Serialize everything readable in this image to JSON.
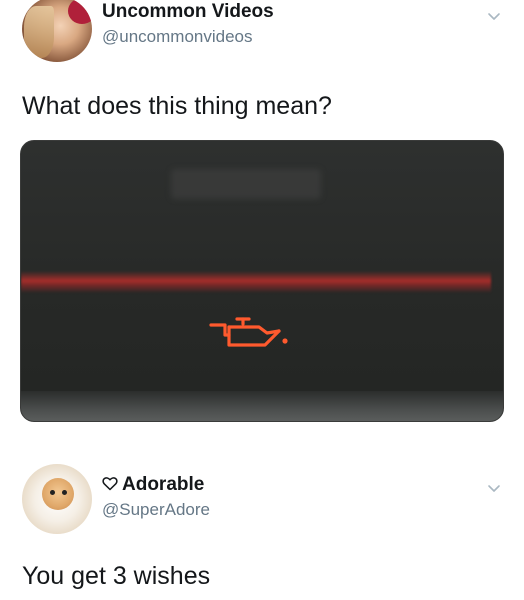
{
  "tweet": {
    "author_name": "Uncommon Videos",
    "author_handle": "@uncommonvideos",
    "text": "What does this thing mean?",
    "media": {
      "icon": "oil-can-warning-icon",
      "glow_color": "#ff5a2e"
    }
  },
  "reply": {
    "author_name": "Adorable",
    "author_handle": "@SuperAdore",
    "name_icon": "heart-outline-icon",
    "text": "You get 3 wishes"
  },
  "colors": {
    "text_primary": "#14171a",
    "text_secondary": "#657786",
    "chevron": "#aab8c2"
  }
}
